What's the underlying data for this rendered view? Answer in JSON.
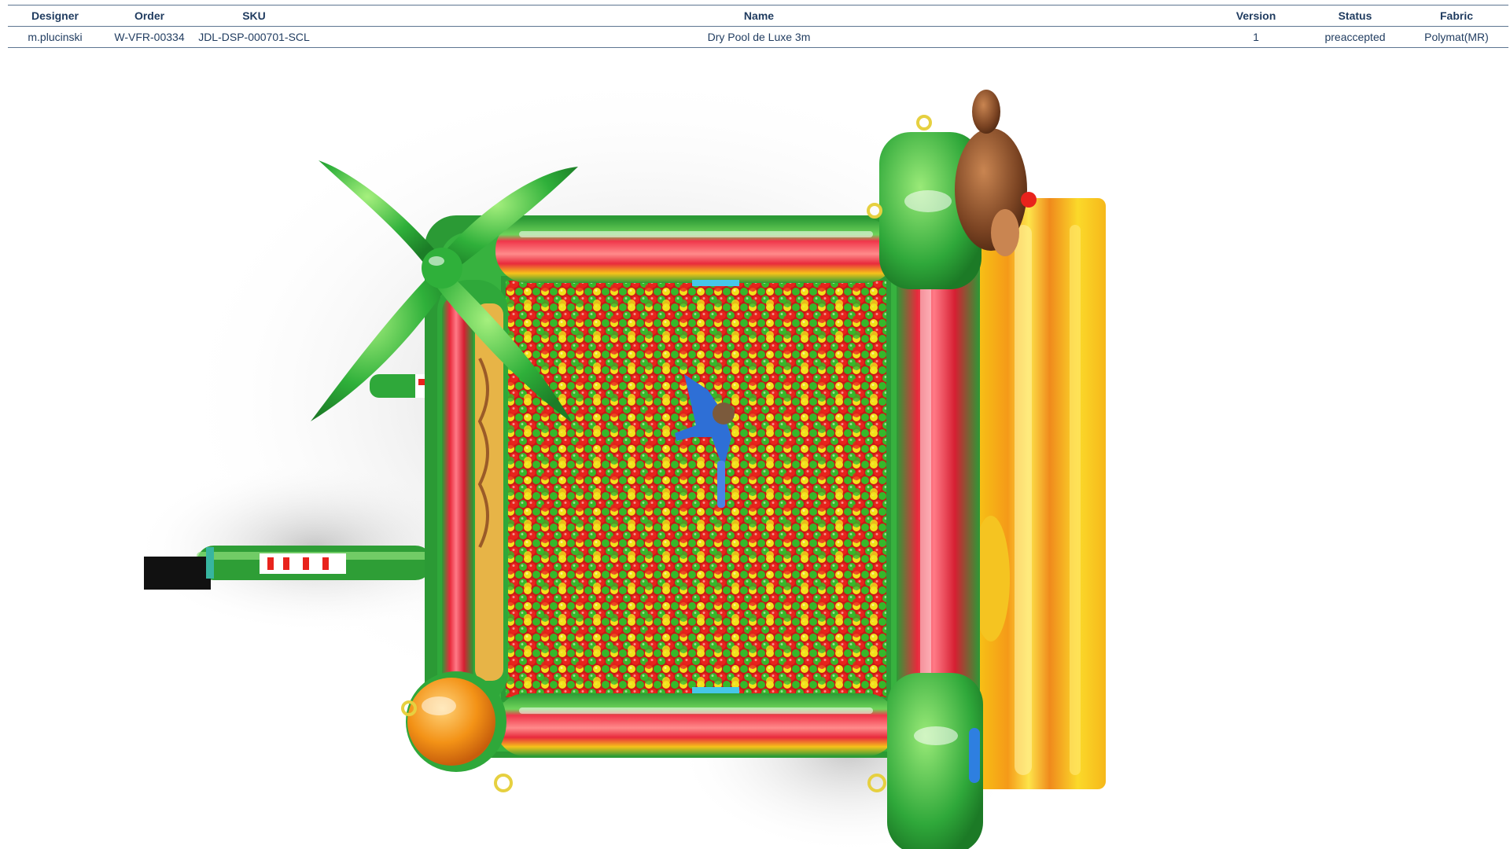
{
  "header": {
    "columns": [
      "Designer",
      "Order",
      "SKU",
      "Name",
      "Version",
      "Status",
      "Fabric"
    ]
  },
  "row": {
    "designer": "m.plucinski",
    "order": "W-VFR-00334",
    "sku": "JDL-DSP-000701-SCL",
    "name": "Dry Pool de Luxe 3m",
    "version": "1",
    "status": "preaccepted",
    "fabric": "Polymat(MR)"
  },
  "colors": {
    "header_text": "#1f3b5f",
    "ball_red": "#e8231c",
    "ball_green": "#35b82a",
    "ball_yellow": "#f2e21a",
    "inflatable_green": "#2fa83a",
    "inflatable_red": "#e82a3c",
    "slide_yellow": "#f8c814",
    "slide_orange": "#f08a1c",
    "monkey_brown": "#7a4322"
  }
}
